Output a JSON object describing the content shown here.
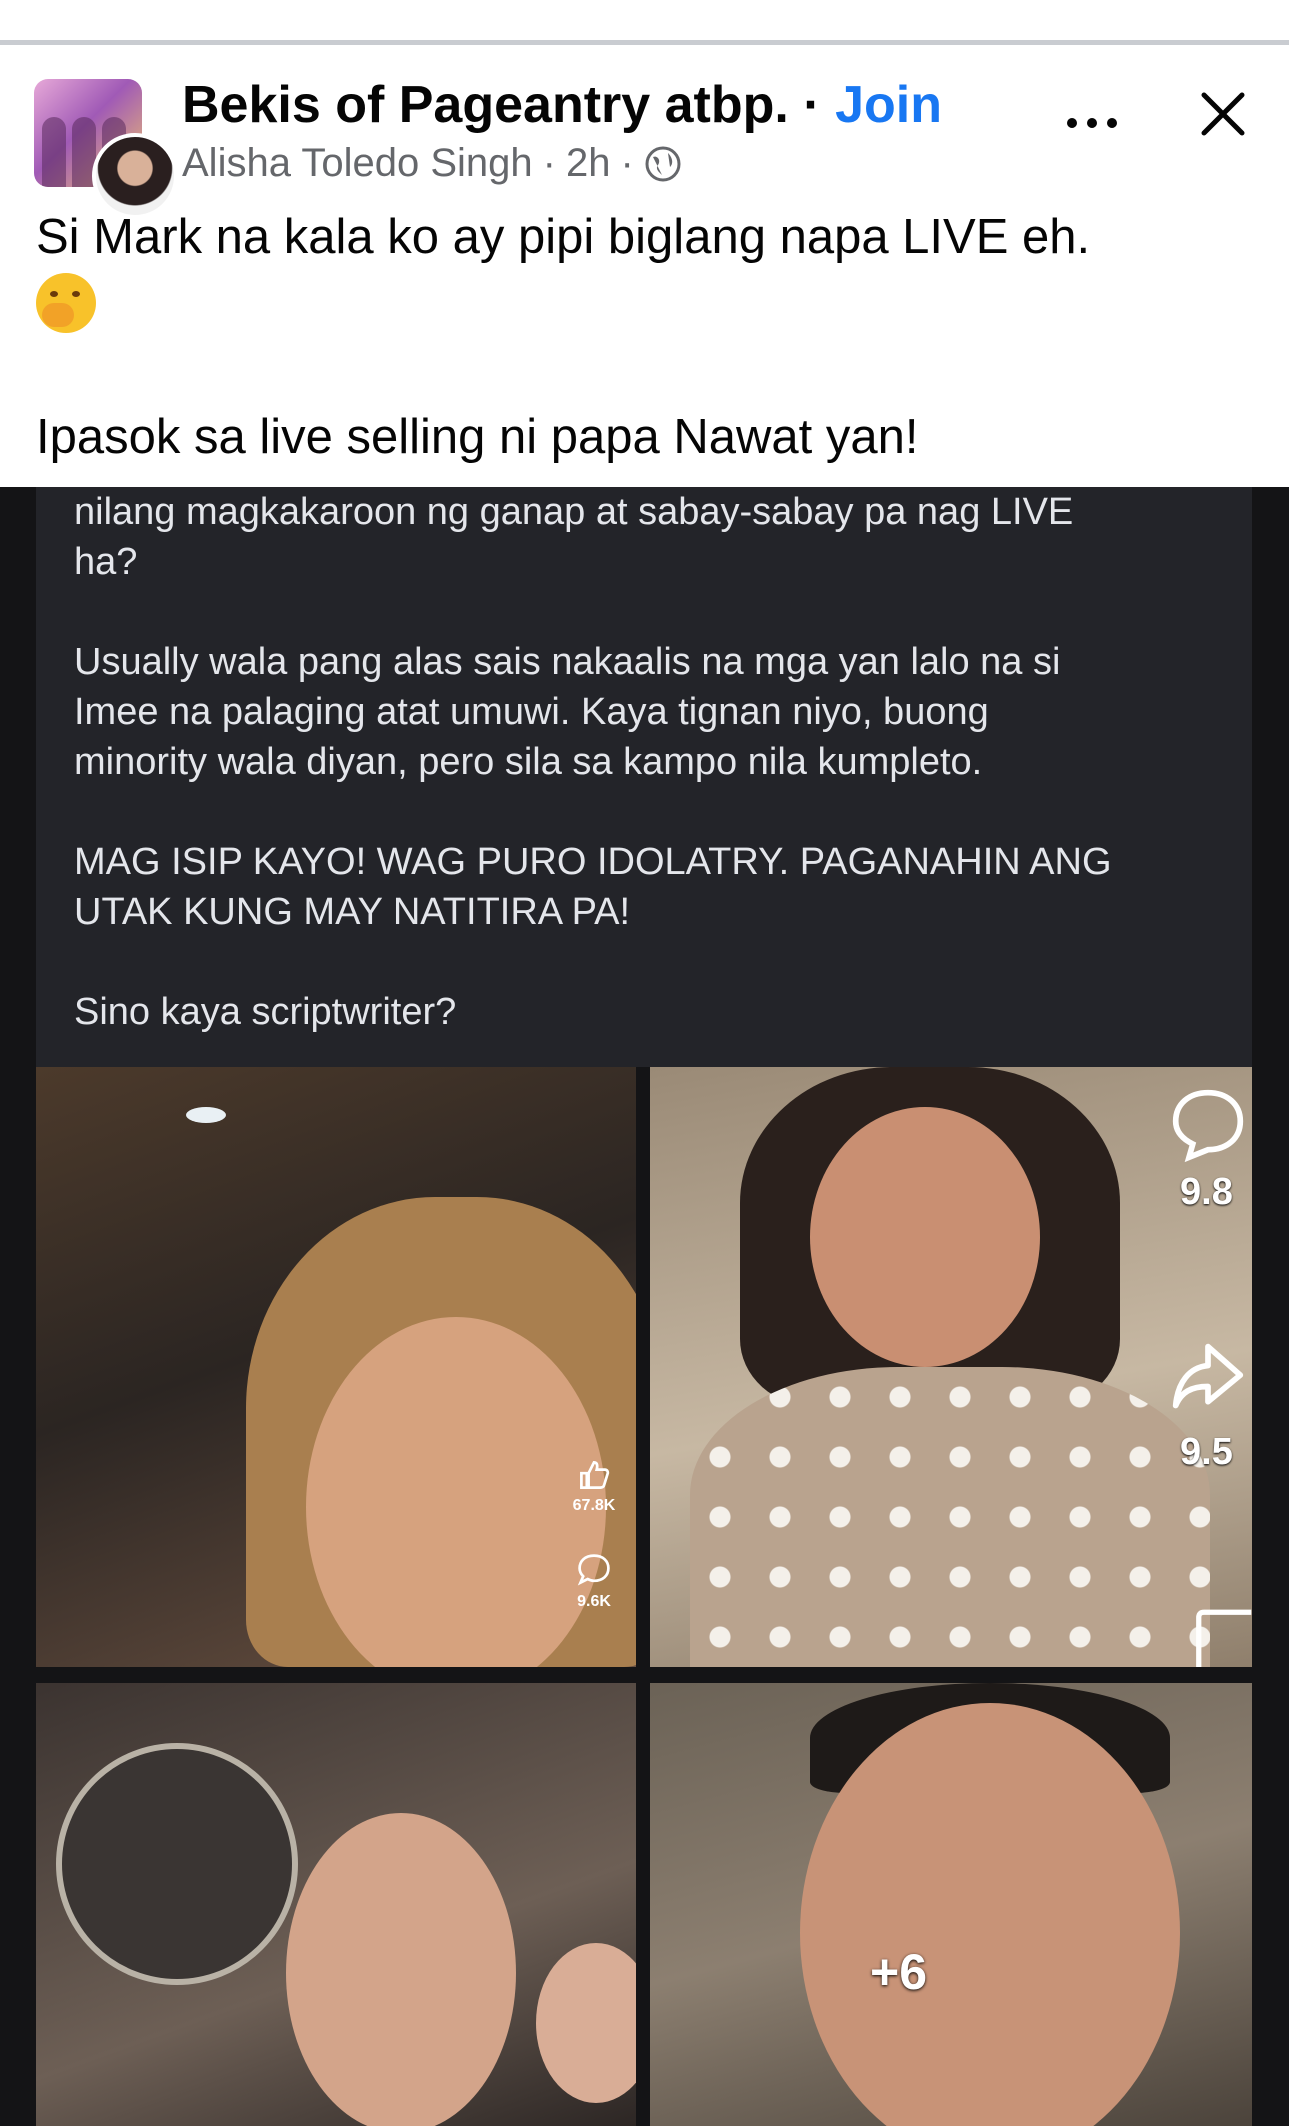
{
  "post_header": {
    "group_name": "Bekis of Pageantry atbp.",
    "separator": "·",
    "join_label": "Join",
    "author": "Alisha Toledo Singh",
    "meta_separator_1": "·",
    "time": "2h",
    "meta_separator_2": "·",
    "privacy_icon": "globe-icon",
    "more_icon": "more-options-icon",
    "close_icon": "close-icon"
  },
  "post_body": {
    "line1": "Si Mark na kala ko ay pipi biglang napa LIVE eh.",
    "emoji": "face-with-hand-over-mouth",
    "line2": "Ipasok sa live selling ni papa Nawat yan!"
  },
  "shared_image": {
    "dark_post_text": "nilang magkakaroon ng ganap at sabay-sabay pa nag LIVE\nha?\n\nUsually wala pang alas sais nakaalis na mga yan lalo na si\nImee na palaging atat umuwi. Kaya tignan niyo, buong\nminority wala diyan, pero sila sa kampo nila kumpleto.\n\nMAG ISIP KAYO! WAG PURO IDOLATRY. PAGANAHIN ANG\nUTAK KUNG MAY NATITIRA PA!\n\nSino kaya scriptwriter?",
    "cell1_like_count": "67.8K",
    "cell1_comment_count": "9.6K",
    "cell2_count_a": "9.8",
    "cell2_count_b": "9.5",
    "more_photos": "+6"
  },
  "colors": {
    "accent": "#1877f2",
    "secondary_text": "#65676b",
    "dark_post_bg": "#232429"
  }
}
